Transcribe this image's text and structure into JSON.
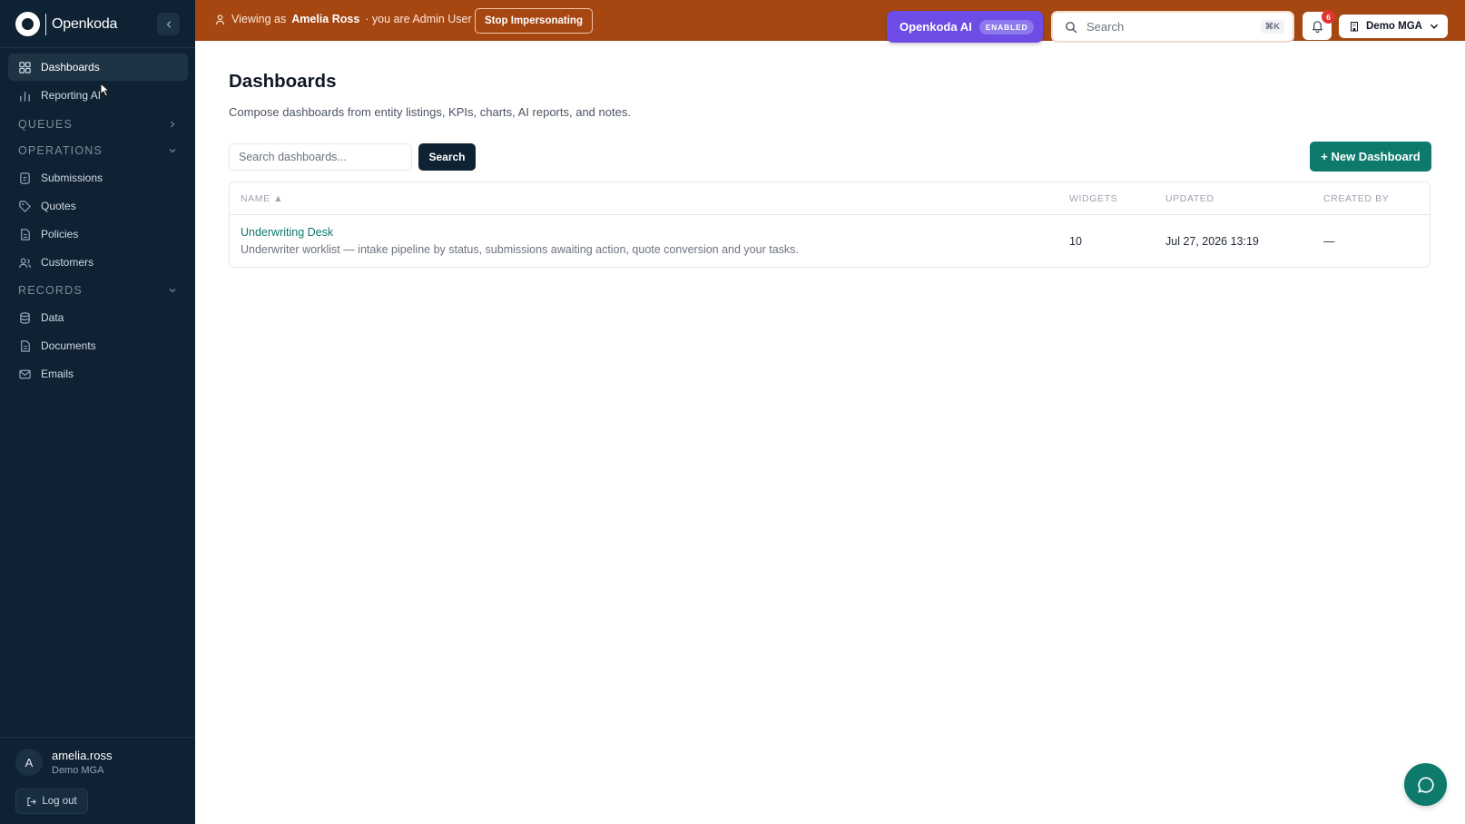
{
  "brand": {
    "name": "Openkoda"
  },
  "sidebar": {
    "primary": [
      {
        "label": "Dashboards",
        "icon": "grid-icon",
        "active": true
      },
      {
        "label": "Reporting AI",
        "icon": "bar-chart-icon"
      }
    ],
    "sections": {
      "queues": {
        "label": "QUEUES"
      },
      "operations": {
        "label": "OPERATIONS"
      },
      "records": {
        "label": "RECORDS"
      }
    },
    "operations_items": [
      {
        "label": "Submissions",
        "icon": "file-icon"
      },
      {
        "label": "Quotes",
        "icon": "tag-icon"
      },
      {
        "label": "Policies",
        "icon": "document-icon"
      },
      {
        "label": "Customers",
        "icon": "users-icon"
      }
    ],
    "records_items": [
      {
        "label": "Data",
        "icon": "database-icon"
      },
      {
        "label": "Documents",
        "icon": "document-icon"
      },
      {
        "label": "Emails",
        "icon": "mail-icon"
      }
    ],
    "user": {
      "initial": "A",
      "name": "amelia.ross",
      "org": "Demo MGA"
    },
    "logout_label": "Log out"
  },
  "topbar": {
    "viewing_prefix": "Viewing as",
    "viewing_name": "Amelia Ross",
    "viewing_suffix": "· you are Admin User",
    "stop_label": "Stop Impersonating",
    "ai_label": "Openkoda AI",
    "ai_badge": "ENABLED",
    "search_placeholder": "Search",
    "search_shortcut": "⌘K",
    "notification_count": "6",
    "org_label": "Demo MGA"
  },
  "main": {
    "title": "Dashboards",
    "subtitle": "Compose dashboards from entity listings, KPIs, charts, AI reports, and notes.",
    "search_placeholder": "Search dashboards...",
    "search_button": "Search",
    "new_button": "+ New Dashboard",
    "table": {
      "headers": {
        "name": "NAME ▲",
        "widgets": "WIDGETS",
        "updated": "UPDATED",
        "created_by": "CREATED BY"
      },
      "rows": [
        {
          "name": "Underwriting Desk",
          "description": "Underwriter worklist — intake pipeline by status, submissions awaiting action, quote conversion and your tasks.",
          "widgets": "10",
          "updated": "Jul 27, 2026 13:19",
          "created_by": "—"
        }
      ]
    }
  },
  "colors": {
    "sidebar_bg": "#0f2233",
    "topbar_bg": "#a64712",
    "accent": "#0d7a6c",
    "ai_purple": "#6d4de6",
    "notification_red": "#e3342f"
  }
}
